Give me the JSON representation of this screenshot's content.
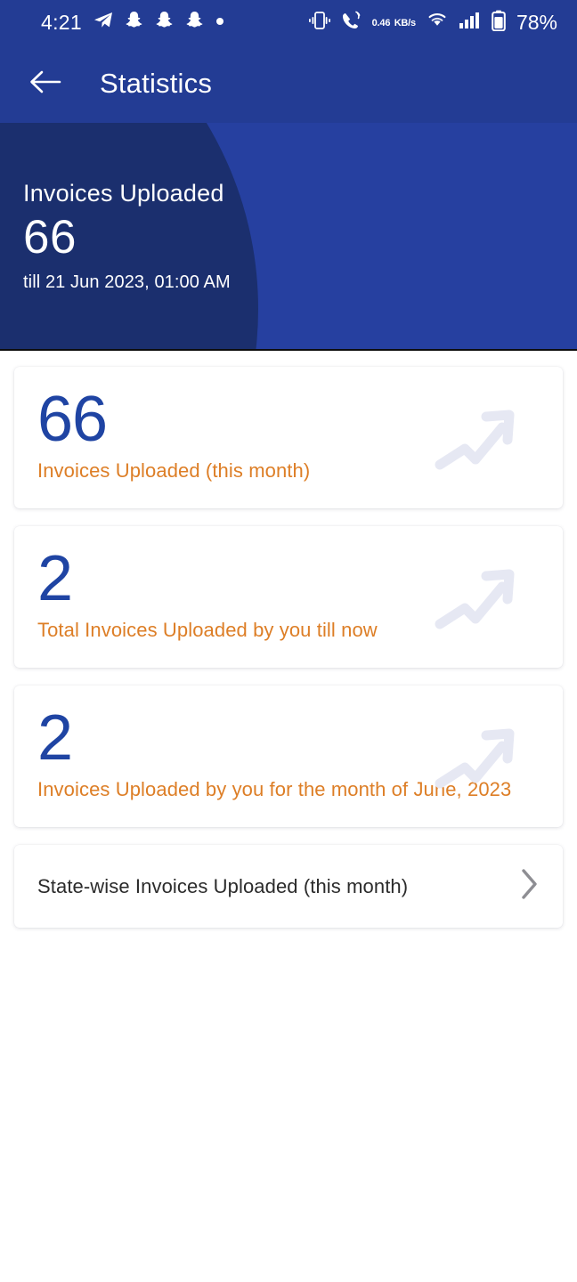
{
  "status_bar": {
    "time": "4:21",
    "network_speed_value": "0.46",
    "network_speed_unit": "KB/s",
    "battery_percent": "78%",
    "left_icons": [
      "telegram-icon",
      "snapchat-icon",
      "snapchat-icon",
      "snapchat-icon",
      "dot-icon"
    ],
    "right_icons": [
      "vibrate-icon",
      "call-icon",
      "wifi-icon",
      "signal-icon",
      "battery-icon"
    ]
  },
  "app_bar": {
    "back_icon": "arrow-left-icon",
    "title": "Statistics"
  },
  "hero": {
    "label": "Invoices Uploaded",
    "value": "66",
    "subtitle": "till 21 Jun 2023, 01:00 AM"
  },
  "cards": [
    {
      "value": "66",
      "label": "Invoices Uploaded (this month)",
      "icon": "trending-up-arrow-icon"
    },
    {
      "value": "2",
      "label": "Total Invoices Uploaded by you till now",
      "icon": "trending-up-arrow-icon"
    },
    {
      "value": "2",
      "label": "Invoices Uploaded by you for the month of June, 2023",
      "icon": "trending-up-arrow-icon"
    }
  ],
  "list_row": {
    "label": "State-wise Invoices Uploaded (this month)",
    "chevron_icon": "chevron-right-icon"
  },
  "colors": {
    "primary_blue": "#233c94",
    "hero_blue": "#2640a0",
    "hero_circle_navy": "#1b2f6e",
    "stat_value_blue": "#1f44a3",
    "stat_label_orange": "#dd7e26",
    "row_label_gray": "#2b2b2b",
    "trend_arrow": "#e6e8f3",
    "card_background": "#ffffff",
    "page_background": "#ffffff"
  }
}
